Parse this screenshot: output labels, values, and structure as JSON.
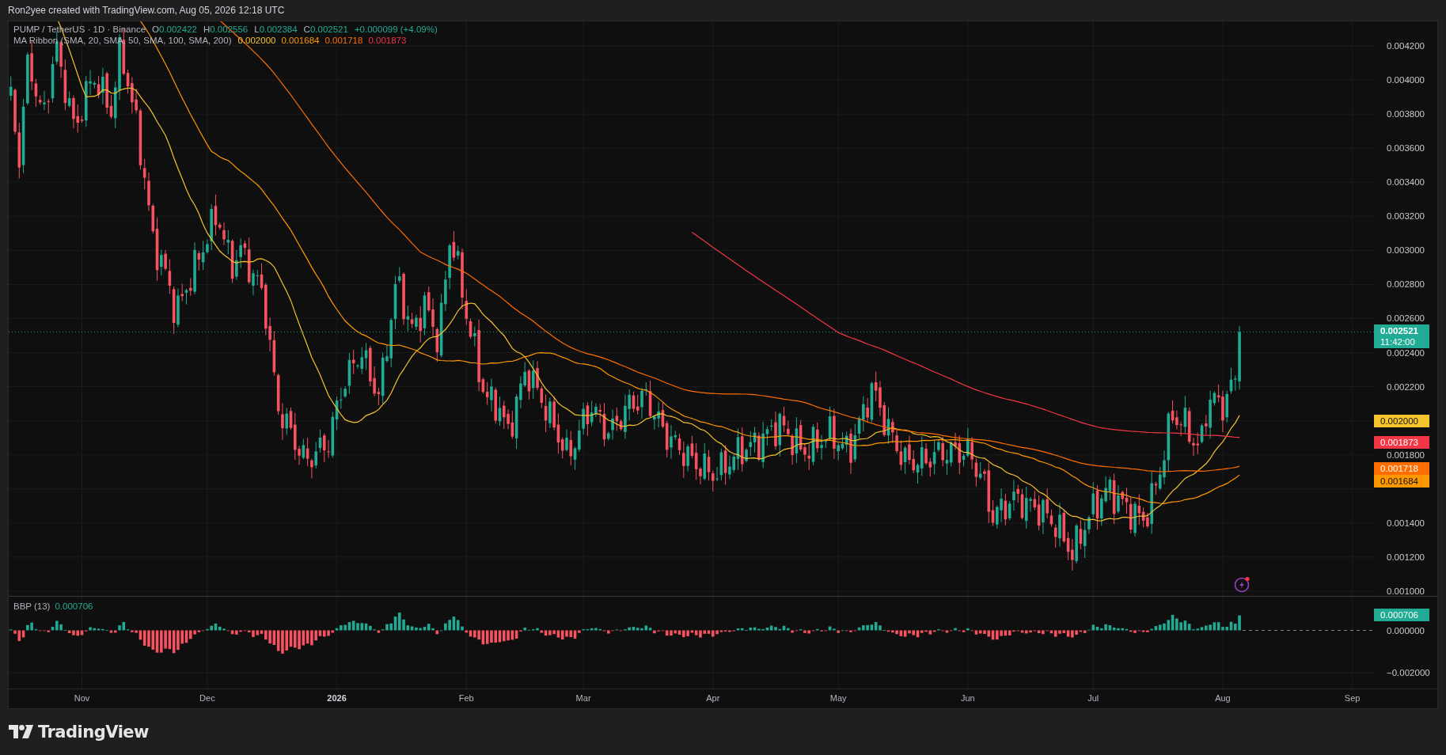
{
  "attribution": "Ron2yee created with TradingView.com, Aug 05, 2026 12:18 UTC",
  "legend": {
    "symbol": "PUMP / TetherUS · 1D · Binance",
    "ohlc": [
      {
        "label": "O",
        "value": "0.002422"
      },
      {
        "label": "H",
        "value": "0.002556"
      },
      {
        "label": "L",
        "value": "0.002384"
      },
      {
        "label": "C",
        "value": "0.002521"
      }
    ],
    "change": "+0.000099 (+4.09%)"
  },
  "ma_ribbon": {
    "label": "MA Ribbon (SMA, 20, SMA, 50, SMA, 100, SMA, 200)",
    "lines": [
      {
        "value": "0.002000",
        "color": "#f5c32c"
      },
      {
        "value": "0.001684",
        "color": "#ff9800"
      },
      {
        "value": "0.001718",
        "color": "#ff6d00"
      },
      {
        "value": "0.001873",
        "color": "#f23645"
      }
    ]
  },
  "price_axis": {
    "ticks": [
      "0.004200",
      "0.004000",
      "0.003800",
      "0.003600",
      "0.003400",
      "0.003200",
      "0.003000",
      "0.002800",
      "0.002600",
      "0.002400",
      "0.002200",
      "0.001800",
      "0.001400",
      "0.001200",
      "0.001000"
    ],
    "last_price": "0.002521",
    "countdown": "11:42:00",
    "ma_tags": [
      {
        "label": "0.002000",
        "color": "#f5c32c"
      },
      {
        "label": "0.001873",
        "color": "#f23645"
      },
      {
        "label": "0.001718",
        "color": "#ff6d00"
      },
      {
        "label": "0.001684",
        "color": "#ff9800"
      }
    ]
  },
  "bbp": {
    "label": "BBP (13)",
    "value": "0.000706",
    "axis_label": "0.000706",
    "ticks": [
      "0.000000",
      "−0.002000"
    ]
  },
  "time_axis": [
    {
      "label": "Nov",
      "kind": "month"
    },
    {
      "label": "Dec",
      "kind": "month"
    },
    {
      "label": "2026",
      "kind": "year"
    },
    {
      "label": "Feb",
      "kind": "month"
    },
    {
      "label": "Mar",
      "kind": "month"
    },
    {
      "label": "Apr",
      "kind": "month"
    },
    {
      "label": "May",
      "kind": "month"
    },
    {
      "label": "Jun",
      "kind": "month"
    },
    {
      "label": "Jul",
      "kind": "month"
    },
    {
      "label": "Aug",
      "kind": "month"
    },
    {
      "label": "Sep",
      "kind": "month"
    }
  ],
  "footer": {
    "logo": "TradingView"
  }
}
